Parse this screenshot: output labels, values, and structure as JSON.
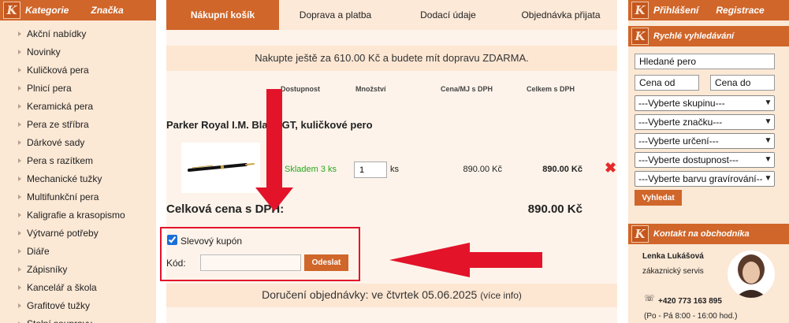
{
  "left": {
    "tabs": [
      "Kategorie",
      "Značka"
    ],
    "categories": [
      "Akční nabídky",
      "Novinky",
      "Kuličková pera",
      "Plnicí pera",
      "Keramická pera",
      "Pera ze stříbra",
      "Dárkové sady",
      "Pera s razítkem",
      "Mechanické tužky",
      "Multifunkční pera",
      "Kaligrafie a krasopismo",
      "Výtvarné potřeby",
      "Diáře",
      "Zápisníky",
      "Kancelář a škola",
      "Grafitové tužky",
      "Stolní soupravy"
    ]
  },
  "steps": [
    "Nákupní košík",
    "Doprava a platba",
    "Dodací údaje",
    "Objednávka přijata"
  ],
  "notice": "Nakupte ještě za 610.00 Kč a budete mít dopravu ZDARMA.",
  "columns": {
    "availability": "Dostupnost",
    "quantity": "Množství",
    "unit_price": "Cena/MJ s DPH",
    "total": "Celkem s DPH"
  },
  "product": {
    "name": "Parker Royal I.M. Black GT, kuličkové pero",
    "stock": "Skladem 3 ks",
    "qty": "1",
    "qty_unit": "ks",
    "unit_price": "890.00 Kč",
    "line_total": "890.00 Kč"
  },
  "totals": {
    "label": "Celková cena s DPH:",
    "value": "890.00 Kč"
  },
  "coupon": {
    "checkbox_label": "Slevový kupón",
    "code_label": "Kód:",
    "code_value": "",
    "submit": "Odeslat"
  },
  "delivery": {
    "text": "Doručení objednávky: ve čtvrtek 05.06.2025",
    "more": "(více info)"
  },
  "right": {
    "tabs": [
      "Přihlášení",
      "Registrace"
    ],
    "quick_search_title": "Rychlé vyhledávání",
    "search_value": "Hledané pero",
    "price_from": "Cena od",
    "price_to": "Cena do",
    "selects": [
      "---Vyberte skupinu---",
      "---Vyberte značku---",
      "---Vyberte určení---",
      "---Vyberte dostupnost---",
      "---Vyberte barvu gravírování---"
    ],
    "search_button": "Vyhledat",
    "contact_title": "Kontakt na obchodníka",
    "contact_name": "Lenka Lukášová",
    "contact_role": "zákaznický servis",
    "contact_phone": "+420 773 163 895",
    "contact_hours": "(Po - Pá 8:00 - 16:00 hod.)"
  },
  "colors": {
    "accent": "#d0662a",
    "panel": "#fbe8d5",
    "arrow": "#e3132a",
    "stock_green": "#2aa61e"
  },
  "icons": [
    "k-logo-icon",
    "delete-x-icon",
    "phone-icon",
    "chevron-down-icon",
    "arrow-down-icon",
    "arrow-left-icon"
  ]
}
